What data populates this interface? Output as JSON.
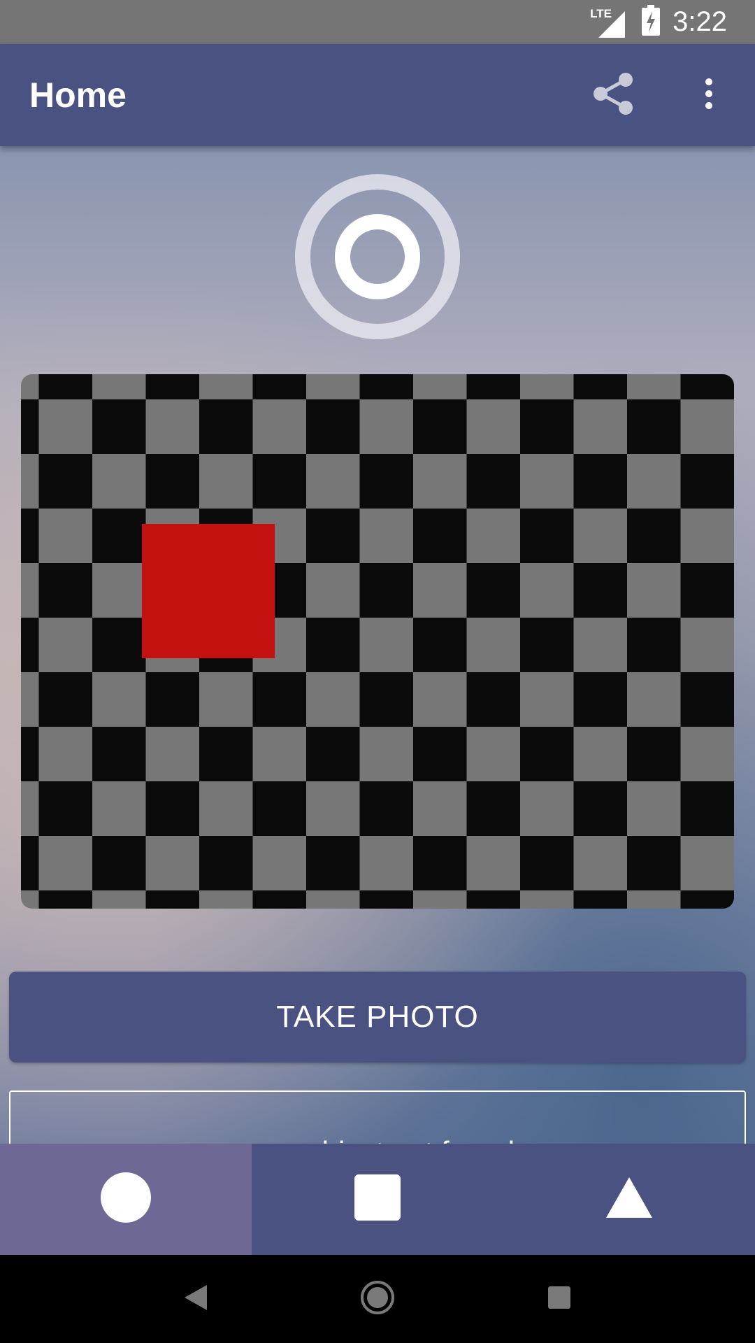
{
  "status_bar": {
    "network": "LTE",
    "time": "3:22"
  },
  "app_bar": {
    "title": "Home",
    "icons": [
      "share-icon",
      "overflow-menu-icon"
    ]
  },
  "camera": {
    "shutter_icon": "shutter-ring-icon",
    "preview": {
      "pattern": "checkerboard",
      "colors": {
        "dark": "#0a0a0a",
        "light": "#777777",
        "marker": "#c4100f"
      }
    }
  },
  "actions": {
    "take_photo_label": "TAKE PHOTO"
  },
  "result": {
    "text": "user object not found"
  },
  "bottom_nav": {
    "items": [
      {
        "icon": "circle-icon",
        "active": true
      },
      {
        "icon": "square-icon",
        "active": false
      },
      {
        "icon": "triangle-icon",
        "active": false
      }
    ]
  },
  "system_nav": {
    "icons": [
      "back-icon",
      "home-icon",
      "recents-icon"
    ]
  },
  "colors": {
    "primary": "#4a5282",
    "nav_active": "#6e6894",
    "status_bar": "#757575"
  }
}
